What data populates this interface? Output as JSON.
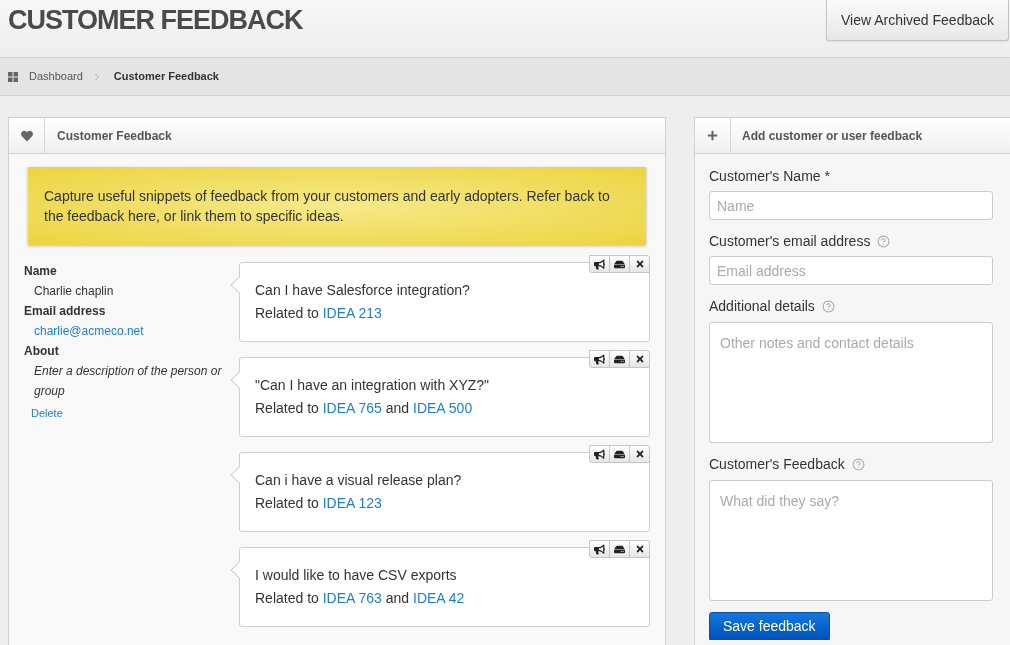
{
  "header": {
    "title": "CUSTOMER FEEDBACK",
    "action": "View Archived Feedback"
  },
  "breadcrumb": [
    {
      "label": "Dashboard",
      "current": false
    },
    {
      "label": "Customer Feedback",
      "current": true
    }
  ],
  "feedback_panel": {
    "title": "Customer Feedback",
    "notice": "Capture useful snippets of feedback from your customers and early adopters. Refer back to the feedback here, or link them to specific ideas.",
    "person": {
      "fields": [
        {
          "label": "Name",
          "value": "Charlie chaplin",
          "kind": "text"
        },
        {
          "label": "Email address",
          "value": "charlie@acmeco.net",
          "kind": "link"
        },
        {
          "label": "About",
          "value": "Enter a description of the person or group",
          "kind": "hint"
        }
      ],
      "delete": "Delete"
    },
    "items": [
      {
        "quote": "Can I have Salesforce integration?",
        "related": [
          {
            "kind": "text",
            "text": "Related to"
          },
          {
            "kind": "link",
            "text": "IDEA 213"
          }
        ]
      },
      {
        "quote": "\"Can I have an integration with XYZ?\"",
        "related": [
          {
            "kind": "text",
            "text": "Related to"
          },
          {
            "kind": "link",
            "text": "IDEA 765"
          },
          {
            "kind": "text",
            "text": "and"
          },
          {
            "kind": "link",
            "text": "IDEA 500"
          }
        ]
      },
      {
        "quote": "Can i have a visual release plan?",
        "related": [
          {
            "kind": "text",
            "text": "Related to"
          },
          {
            "kind": "link",
            "text": "IDEA 123"
          }
        ]
      },
      {
        "quote": "I would like to have CSV exports",
        "related": [
          {
            "kind": "text",
            "text": "Related to"
          },
          {
            "kind": "link",
            "text": "IDEA 763"
          },
          {
            "kind": "text",
            "text": "and"
          },
          {
            "kind": "link",
            "text": "IDEA 42"
          }
        ]
      }
    ]
  },
  "form_panel": {
    "title": "Add customer or user feedback",
    "fields": [
      {
        "label": "Customer's Name *",
        "placeholder": "Name",
        "kind": "input",
        "help": false
      },
      {
        "label": "Customer's email address",
        "placeholder": "Email address",
        "kind": "input",
        "help": true
      },
      {
        "label": "Additional details",
        "placeholder": "Other notes and contact details",
        "kind": "textarea",
        "help": true
      },
      {
        "label": "Customer's Feedback",
        "placeholder": "What did they say?",
        "kind": "textarea",
        "help": true
      }
    ],
    "submit": "Save feedback"
  }
}
